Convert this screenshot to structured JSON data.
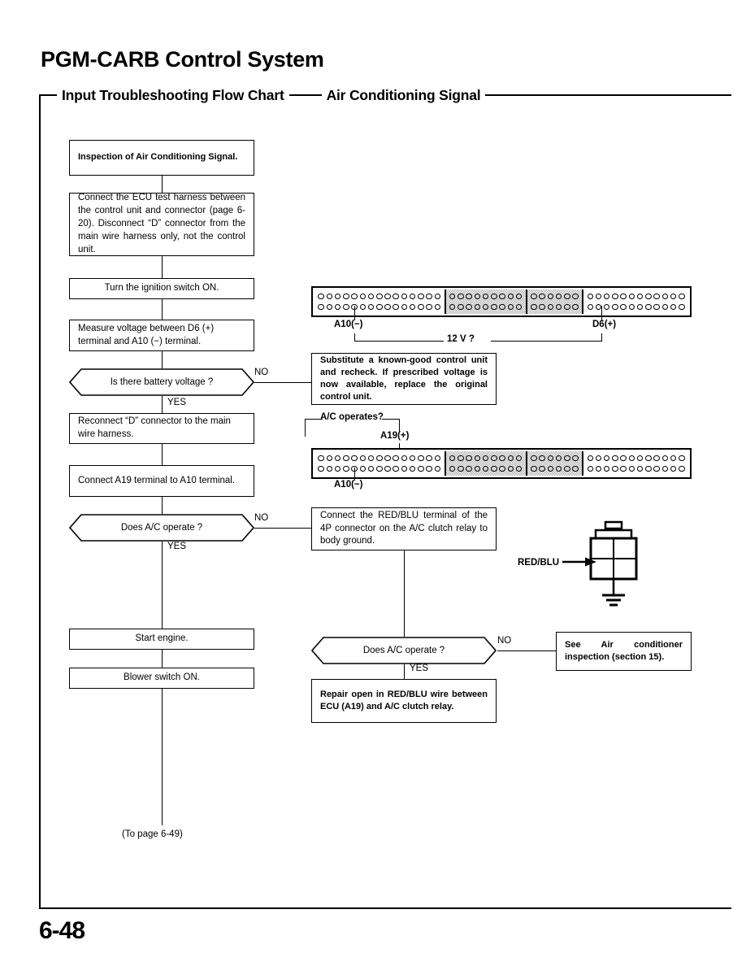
{
  "header": {
    "main_title": "PGM-CARB Control System",
    "left_label": "Input Troubleshooting Flow Chart",
    "right_label": "Air Conditioning Signal"
  },
  "page_number": "6-48",
  "flow": {
    "box_inspection": "Inspection of Air Conditioning Signal.",
    "box_connect_ecu": "Connect the ECU test harness between the control unit and connector (page 6-20). Disconnect “D” connector from the main wire harness only, not the control unit.",
    "box_ignition": "Turn the ignition switch ON.",
    "box_measure": "Measure voltage between D6 (+) terminal and A10 (−) terminal.",
    "decision_battery": "Is there battery voltage ?",
    "box_substitute": "Substitute a known-good control unit and recheck. If prescribed voltage is now available, replace the original control unit.",
    "box_reconnect": "Reconnect “D” connector to the main wire harness.",
    "box_connect_a19": "Connect A19 terminal to A10 terminal.",
    "decision_ac_1": "Does A/C operate ?",
    "box_connect_redblu": "Connect the RED/BLU terminal of the 4P connector on the A/C clutch relay to body ground.",
    "box_start_engine": "Start engine.",
    "box_blower": "Blower switch ON.",
    "decision_ac_2": "Does A/C operate ?",
    "box_see_air_cond": "See Air conditioner inspection (section 15).",
    "box_repair_open": "Repair open in RED/BLU wire between ECU (A19) and A/C clutch relay.",
    "to_page": "(To page 6-49)",
    "label_no_1": "NO",
    "label_yes_1": "YES",
    "label_no_2": "NO",
    "label_yes_2": "YES",
    "label_no_3": "NO",
    "label_yes_3": "YES"
  },
  "connector_top": {
    "label_left": "A10(−)",
    "label_right": "D6(+)",
    "measure_label": "12 V ?",
    "segments": [
      {
        "shaded": false,
        "pins_per_row": 15,
        "rows": 2
      },
      {
        "shaded": true,
        "pins_per_row": 9,
        "rows": 2
      },
      {
        "shaded": true,
        "pins_per_row": 6,
        "rows": 2
      },
      {
        "shaded": false,
        "pins_per_row": 12,
        "rows": 2
      }
    ]
  },
  "connector_bottom": {
    "label_top": "A19(+)",
    "label_bottom": "A10(−)",
    "operates_label": "A/C operates?",
    "segments": [
      {
        "shaded": false,
        "pins_per_row": 15,
        "rows": 2
      },
      {
        "shaded": true,
        "pins_per_row": 9,
        "rows": 2
      },
      {
        "shaded": true,
        "pins_per_row": 6,
        "rows": 2
      },
      {
        "shaded": false,
        "pins_per_row": 12,
        "rows": 2
      }
    ]
  },
  "relay": {
    "wire_label": "RED/BLU"
  }
}
